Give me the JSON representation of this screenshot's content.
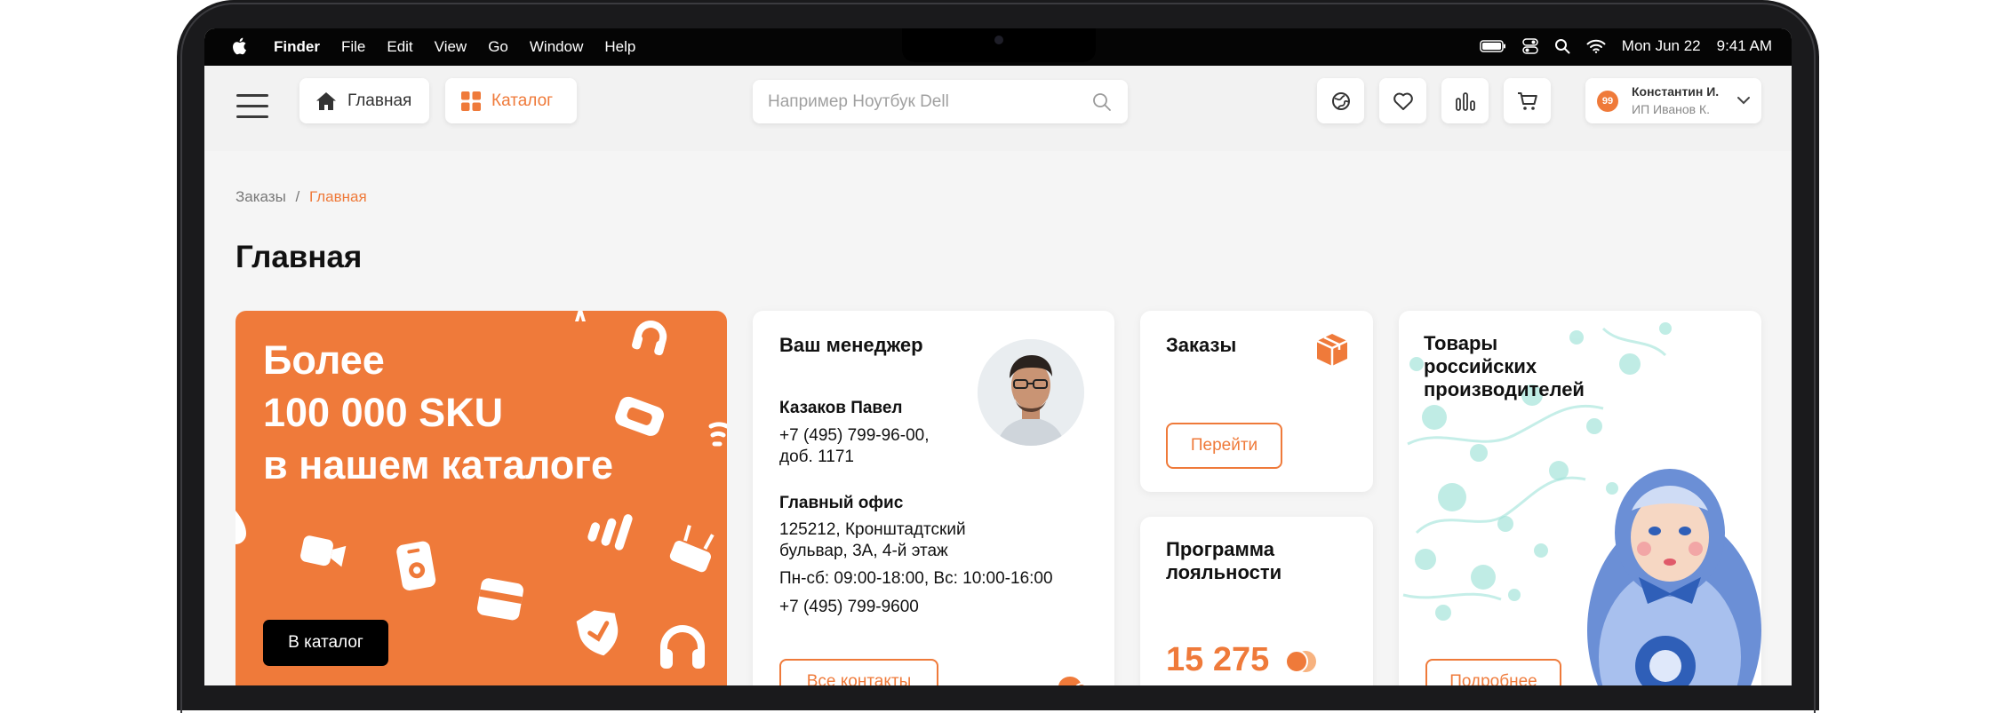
{
  "menubar": {
    "app": "Finder",
    "menus": [
      "File",
      "Edit",
      "View",
      "Go",
      "Window",
      "Help"
    ],
    "date": "Mon Jun 22",
    "time": "9:41 AM"
  },
  "header": {
    "home_label": "Главная",
    "catalog_label": "Каталог",
    "search_placeholder": "Например Ноутбук Dell",
    "user_badge": "99",
    "user_name": "Константин И.",
    "user_company": "ИП Иванов К."
  },
  "breadcrumb": {
    "parent": "Заказы",
    "separator": "/",
    "current": "Главная"
  },
  "page_title": "Главная",
  "promo": {
    "line1": "Более",
    "line2": "100 000 SKU",
    "line3": "в нашем каталоге",
    "button": "В каталог"
  },
  "manager": {
    "title": "Ваш менеджер",
    "name": "Казаков Павел",
    "phone": "+7 (495) 799-96-00,",
    "ext": "доб. 1171",
    "office_title": "Главный офис",
    "address1": "125212, Кронштадтский",
    "address2": "бульвар, 3А, 4-й этаж",
    "hours": "Пн-сб: 09:00-18:00, Вс: 10:00-16:00",
    "office_phone": "+7 (495) 799-9600",
    "button": "Все контакты"
  },
  "orders": {
    "title": "Заказы",
    "button": "Перейти"
  },
  "loyalty": {
    "title1": "Программа",
    "title2": "лояльности",
    "points": "15 275"
  },
  "russian": {
    "line1": "Товары",
    "line2": "российских",
    "line3": "производителей",
    "button": "Подробнее"
  },
  "colors": {
    "accent": "#ef7a3a",
    "background": "#f5f5f5",
    "menubar": "#050505"
  }
}
